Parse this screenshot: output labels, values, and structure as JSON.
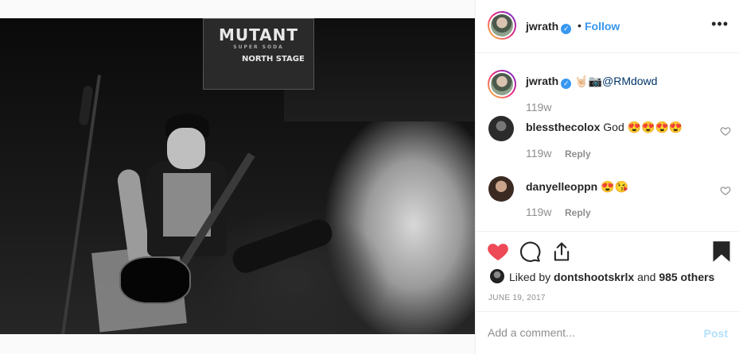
{
  "photo": {
    "banner_title": "MUTANT",
    "banner_sub": "SUPER SODA",
    "banner_stage": "NORTH STAGE"
  },
  "header": {
    "username": "jwrath",
    "verified_mark": "✓",
    "separator": "•",
    "follow_label": "Follow",
    "more_label": "•••"
  },
  "caption": {
    "username": "jwrath",
    "text": "🤘🏻📷",
    "mention": "@RMdowd",
    "time": "119w"
  },
  "comments": [
    {
      "username": "blessthecolox",
      "text": "God 😍😍😍😍",
      "time": "119w",
      "reply_label": "Reply"
    },
    {
      "username": "danyelleoppn",
      "text": "😍😘",
      "time": "119w",
      "reply_label": "Reply"
    }
  ],
  "actions": {
    "liked_prefix": "Liked by",
    "liked_user": "dontshootskrlx",
    "liked_joiner": "and",
    "liked_others": "985 others",
    "date": "JUNE 19, 2017"
  },
  "composer": {
    "placeholder": "Add a comment...",
    "post_label": "Post"
  },
  "colors": {
    "accent": "#3897f0",
    "like_red": "#ed4956",
    "muted": "#8e8e8e",
    "post_disabled": "#b2dffc"
  },
  "icons": [
    "verified-icon",
    "more-icon",
    "heart-icon",
    "comment-icon",
    "share-icon",
    "bookmark-icon",
    "comment-like-icon"
  ]
}
